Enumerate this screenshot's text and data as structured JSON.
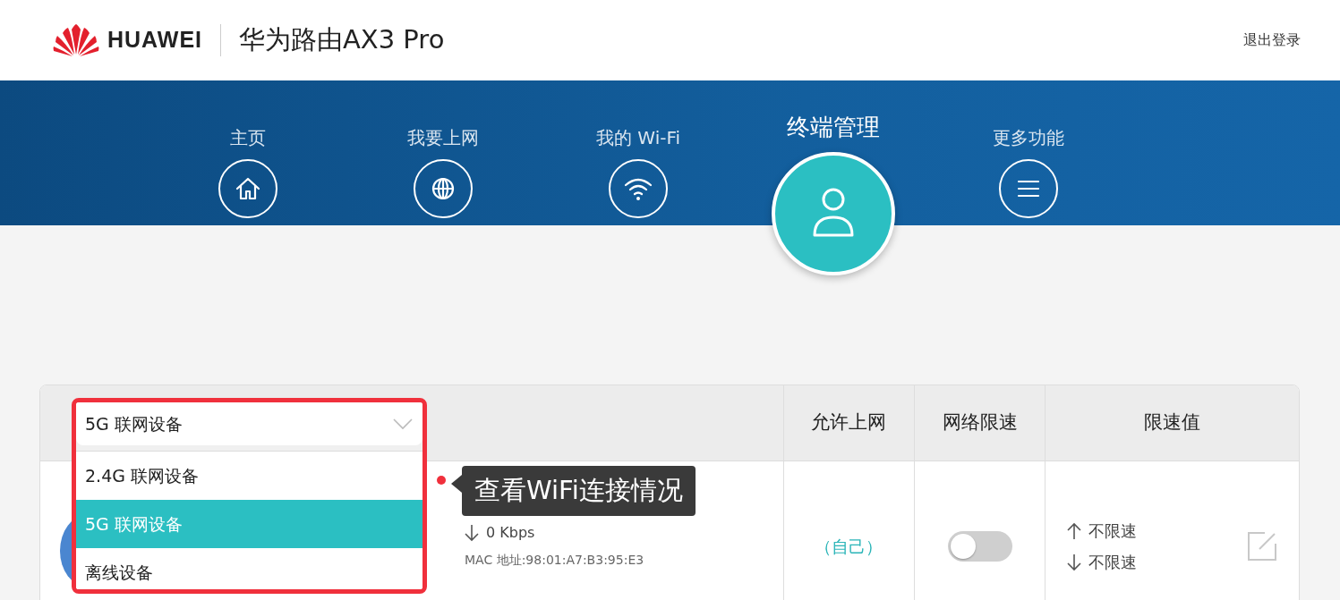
{
  "header": {
    "brand": "HUAWEI",
    "product": "华为路由AX3 Pro",
    "logout": "退出登录"
  },
  "nav": [
    {
      "label": "主页",
      "selected": false
    },
    {
      "label": "我要上网",
      "selected": false
    },
    {
      "label": "我的 Wi-Fi",
      "selected": false
    },
    {
      "label": "终端管理",
      "selected": true
    },
    {
      "label": "更多功能",
      "selected": false
    }
  ],
  "table": {
    "filter": {
      "value": "5G 联网设备",
      "options": [
        {
          "label": "2.4G 联网设备",
          "selected": false
        },
        {
          "label": "5G 联网设备",
          "selected": true
        },
        {
          "label": "离线设备",
          "selected": false
        }
      ]
    },
    "columns": [
      "允许上网",
      "网络限速",
      "限速值"
    ],
    "rows": [
      {
        "download": "0 Kbps",
        "mac": "MAC 地址:98:01:A7:B3:95:E3",
        "access": "（自己）",
        "limit_on": false,
        "up_limit": "不限速",
        "down_limit": "不限速"
      }
    ]
  },
  "annotation": {
    "text": "查看WiFi连接情况"
  }
}
